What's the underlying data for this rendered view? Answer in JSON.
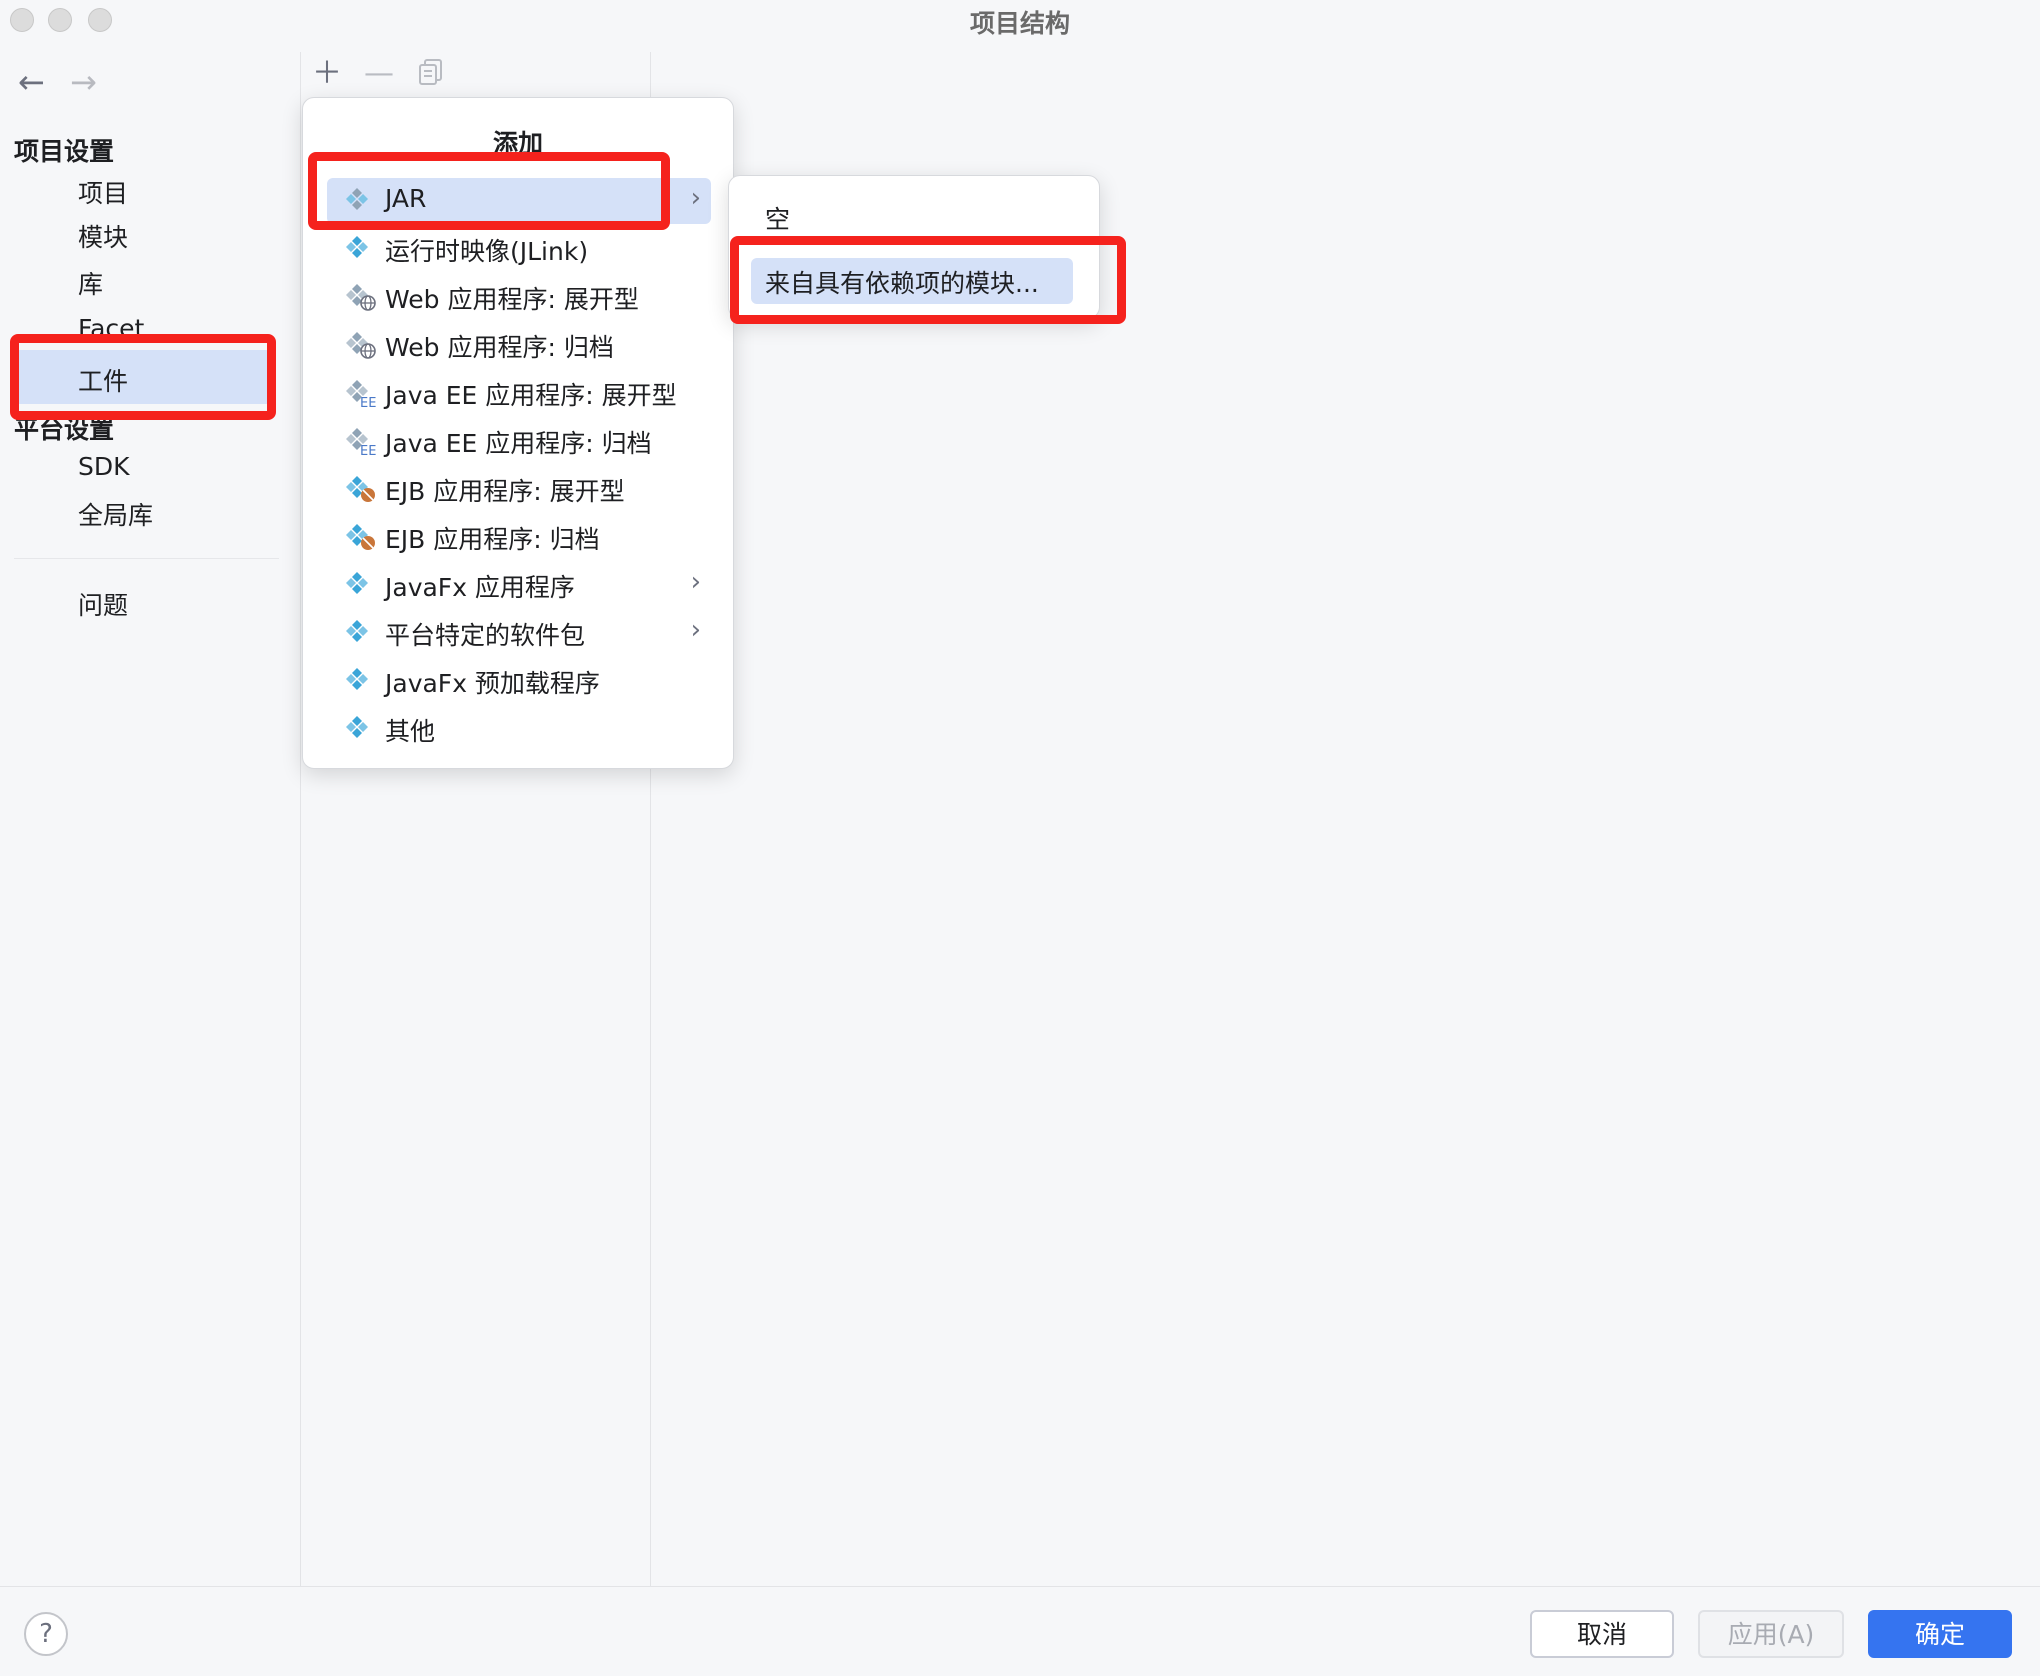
{
  "window": {
    "title": "项目结构"
  },
  "sidebar": {
    "project_settings_header": "项目设置",
    "items": [
      {
        "label": "项目"
      },
      {
        "label": "模块"
      },
      {
        "label": "库"
      },
      {
        "label": "Facet"
      },
      {
        "label": "工件",
        "selected": true
      }
    ],
    "platform_settings_header": "平台设置",
    "platform_items": [
      {
        "label": "SDK"
      },
      {
        "label": "全局库"
      }
    ],
    "problems_label": "问题"
  },
  "toolbar": {
    "add_icon": "plus-icon",
    "remove_icon": "minus-icon",
    "copy_icon": "copy-icon"
  },
  "add_menu": {
    "title": "添加",
    "items": [
      {
        "label": "JAR",
        "icon": "artifact-icon",
        "has_submenu": true,
        "selected": true
      },
      {
        "label": "运行时映像(JLink)",
        "icon": "artifact-icon"
      },
      {
        "label": "Web 应用程序: 展开型",
        "icon": "web-artifact-icon"
      },
      {
        "label": "Web 应用程序: 归档",
        "icon": "web-artifact-icon"
      },
      {
        "label": "Java EE 应用程序: 展开型",
        "icon": "javaee-artifact-icon"
      },
      {
        "label": "Java EE 应用程序: 归档",
        "icon": "javaee-artifact-icon"
      },
      {
        "label": "EJB 应用程序: 展开型",
        "icon": "ejb-artifact-icon"
      },
      {
        "label": "EJB 应用程序: 归档",
        "icon": "ejb-artifact-icon"
      },
      {
        "label": "JavaFx 应用程序",
        "icon": "artifact-icon",
        "has_submenu": true
      },
      {
        "label": "平台特定的软件包",
        "icon": "artifact-icon",
        "has_submenu": true
      },
      {
        "label": "JavaFx 预加载程序",
        "icon": "artifact-icon"
      },
      {
        "label": "其他",
        "icon": "artifact-icon"
      }
    ]
  },
  "jar_submenu": {
    "items": [
      {
        "label": "空"
      },
      {
        "label": "来自具有依赖项的模块...",
        "selected": true
      }
    ]
  },
  "footer": {
    "help": "?",
    "cancel": "取消",
    "apply": "应用(A)",
    "ok": "确定"
  },
  "colors": {
    "accent": "#3574f0",
    "selection": "#d5e1f8",
    "highlight": "#f5221d",
    "artifact_blue": "#3aa5d8",
    "ejb_orange": "#c9763a"
  }
}
